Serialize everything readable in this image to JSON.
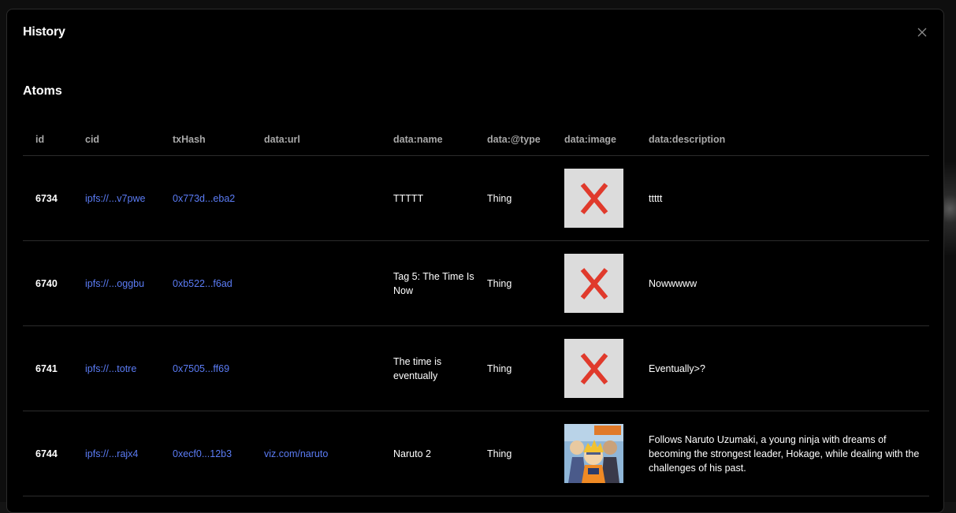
{
  "modal": {
    "title": "History",
    "close_icon": "close-icon"
  },
  "section": {
    "title": "Atoms"
  },
  "table": {
    "columns": [
      "id",
      "cid",
      "txHash",
      "data:url",
      "data:name",
      "data:@type",
      "data:image",
      "data:description"
    ],
    "rows": [
      {
        "id": "6734",
        "cid": "ipfs://...v7pwe",
        "txHash": "0x773d...eba2",
        "url": "",
        "name": "TTTTT",
        "type": "Thing",
        "image": "broken-image-x-icon",
        "description": "ttttt"
      },
      {
        "id": "6740",
        "cid": "ipfs://...oggbu",
        "txHash": "0xb522...f6ad",
        "url": "",
        "name": "Tag 5: The Time Is Now",
        "type": "Thing",
        "image": "broken-image-x-icon",
        "description": "Nowwwww"
      },
      {
        "id": "6741",
        "cid": "ipfs://...totre",
        "txHash": "0x7505...ff69",
        "url": "",
        "name": "The time is eventually",
        "type": "Thing",
        "image": "broken-image-x-icon",
        "description": "Eventually>?"
      },
      {
        "id": "6744",
        "cid": "ipfs://...rajx4",
        "txHash": "0xecf0...12b3",
        "url": "viz.com/naruto",
        "name": "Naruto 2",
        "type": "Thing",
        "image": "naruto-cover-image",
        "description": "Follows Naruto Uzumaki, a young ninja with dreams of becoming the strongest leader, Hokage, while dealing with the challenges of his past."
      }
    ]
  },
  "colors": {
    "background": "#000000",
    "link": "#5b7cf5",
    "header_text": "#a8a8a8",
    "divider": "#2c2c2c",
    "x_mark": "#e03a2c",
    "thumb_bg": "#dcdcdc"
  }
}
